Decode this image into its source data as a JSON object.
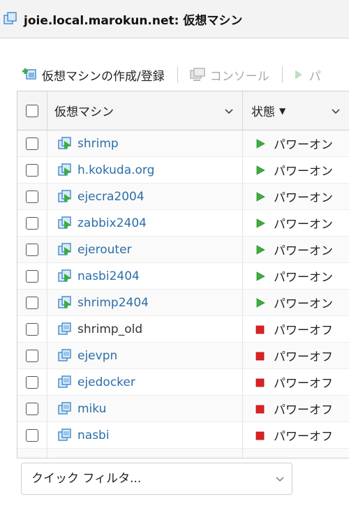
{
  "window": {
    "title": "joie.local.marokun.net: 仮想マシン"
  },
  "toolbar": {
    "create_label": "仮想マシンの作成/登録",
    "console_label": "コンソール",
    "power_label": "パ"
  },
  "grid": {
    "columns": {
      "name": "仮想マシン",
      "state": "状態"
    },
    "rows": [
      {
        "name": "shrimp",
        "state": "パワーオン",
        "on": true,
        "link": true
      },
      {
        "name": "h.kokuda.org",
        "state": "パワーオン",
        "on": true,
        "link": true
      },
      {
        "name": "ejecra2004",
        "state": "パワーオン",
        "on": true,
        "link": true
      },
      {
        "name": "zabbix2404",
        "state": "パワーオン",
        "on": true,
        "link": true
      },
      {
        "name": "ejerouter",
        "state": "パワーオン",
        "on": true,
        "link": true
      },
      {
        "name": "nasbi2404",
        "state": "パワーオン",
        "on": true,
        "link": true
      },
      {
        "name": "shrimp2404",
        "state": "パワーオン",
        "on": true,
        "link": true
      },
      {
        "name": "shrimp_old",
        "state": "パワーオフ",
        "on": false,
        "link": false
      },
      {
        "name": "ejevpn",
        "state": "パワーオフ",
        "on": false,
        "link": true
      },
      {
        "name": "ejedocker",
        "state": "パワーオフ",
        "on": false,
        "link": true
      },
      {
        "name": "miku",
        "state": "パワーオフ",
        "on": false,
        "link": true
      },
      {
        "name": "nasbi",
        "state": "パワーオフ",
        "on": false,
        "link": true
      }
    ]
  },
  "filter": {
    "placeholder": "クイック フィルタ..."
  },
  "colors": {
    "link": "#2b6ea8",
    "power_on": "#3cae3c",
    "power_off": "#e02020"
  }
}
